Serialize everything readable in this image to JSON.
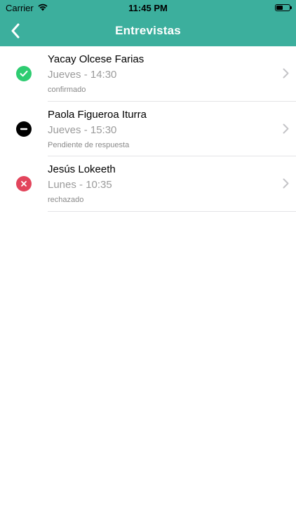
{
  "status_bar": {
    "carrier": "Carrier",
    "time": "11:45 PM"
  },
  "nav": {
    "title": "Entrevistas",
    "back_icon": "chevron-left-icon"
  },
  "colors": {
    "header": "#3caf9d",
    "confirmed": "#2ecc71",
    "pending": "#000000",
    "rejected": "#e2455c"
  },
  "interviews": [
    {
      "name": "Yacay Olcese Farias",
      "schedule": "Jueves - 14:30",
      "status": "confirmado",
      "icon": "check-circle-icon"
    },
    {
      "name": "Paola Figueroa Iturra",
      "schedule": "Jueves - 15:30",
      "status": "Pendiente de respuesta",
      "icon": "minus-circle-icon"
    },
    {
      "name": "Jesús Lokeeth",
      "schedule": "Lunes - 10:35",
      "status": "rechazado",
      "icon": "x-circle-icon"
    }
  ]
}
